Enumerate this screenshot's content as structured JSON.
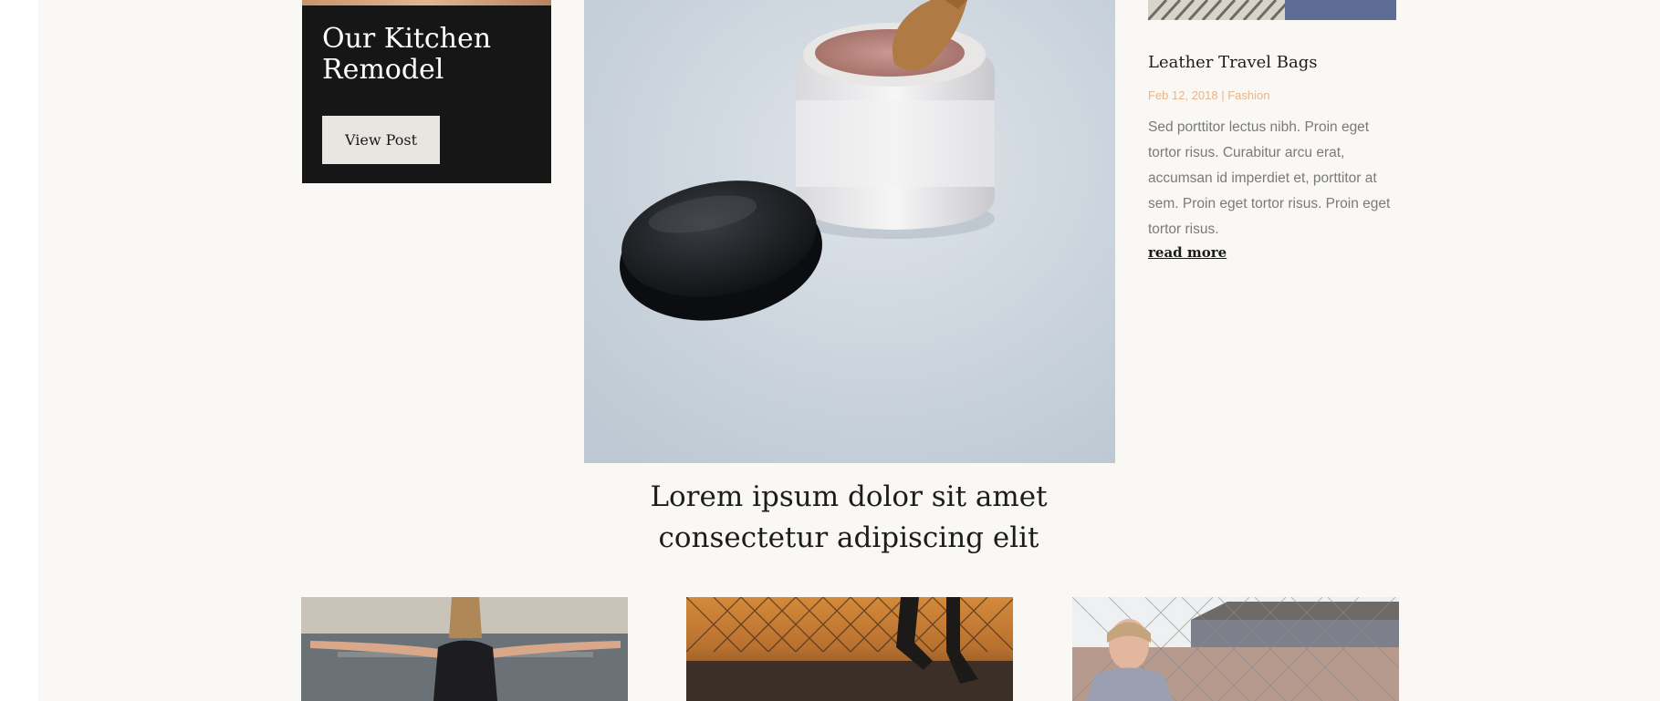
{
  "kitchen": {
    "title": "Our Kitchen Remodel",
    "button_label": "View Post"
  },
  "featured": {
    "heading": "Lorem ipsum dolor sit amet consectetur adipiscing elit"
  },
  "side_post": {
    "title": "Leather Travel Bags",
    "meta": "Feb 12, 2018 | Fashion",
    "excerpt": "Sed porttitor lectus nibh. Proin eget tortor risus. Curabitur arcu erat, accumsan id imperdiet et, porttitor at sem. Proin eget tortor risus. Proin eget tortor risus.",
    "read_more": "read more"
  },
  "colors": {
    "page_background": "#faf8f4",
    "card_dark": "#161616",
    "meta_accent": "#e8b48a"
  }
}
